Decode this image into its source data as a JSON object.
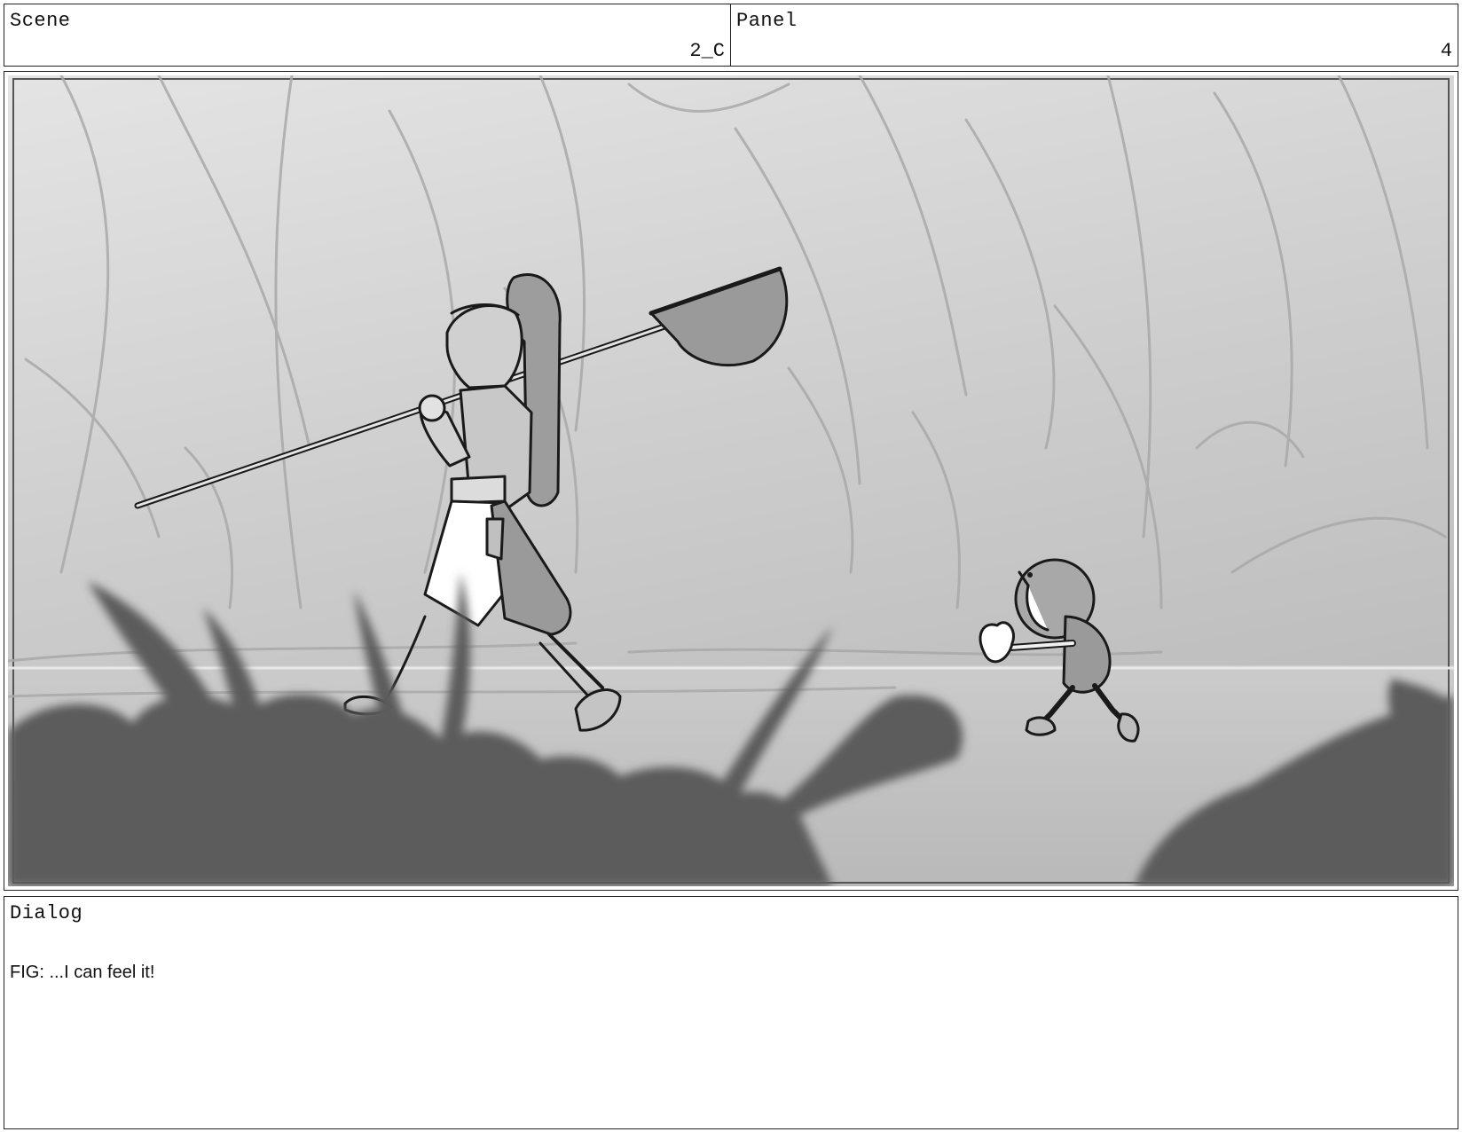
{
  "header": {
    "scene_label": "Scene",
    "scene_value": "2_C",
    "panel_label": "Panel",
    "panel_value": "4"
  },
  "frame": {
    "description_icon": "storyboard-drawing",
    "colors": {
      "sky_light": "#e2e2e2",
      "sky_mid": "#bdbdbd",
      "ground": "#c4c4c4",
      "foliage_dark": "#5a5a5a"
    }
  },
  "dialog": {
    "label": "Dialog",
    "line": "FIG: ...I can feel it!"
  }
}
